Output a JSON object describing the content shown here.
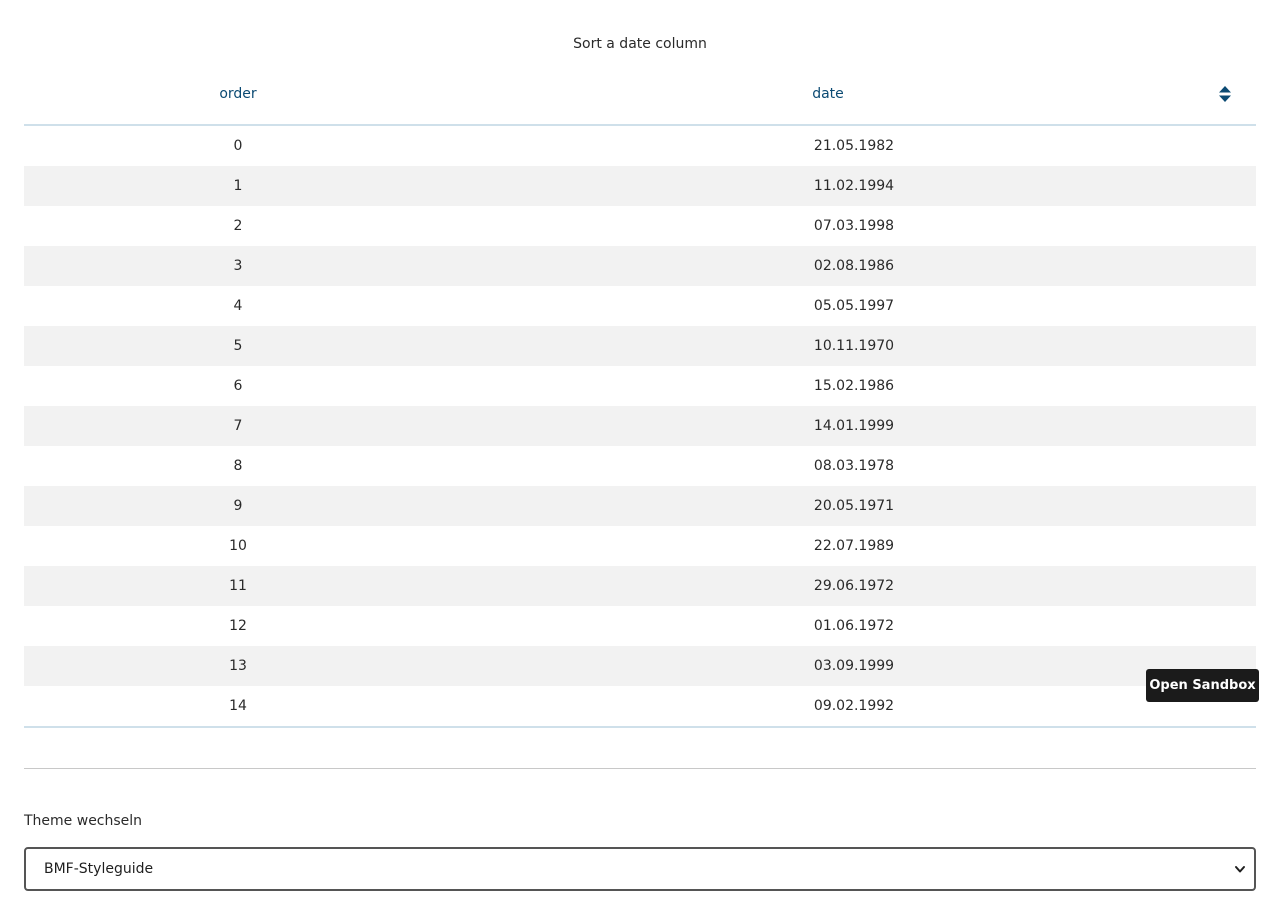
{
  "caption": "Sort a date column",
  "table": {
    "headers": {
      "order": "order",
      "date": "date"
    },
    "sort_icon": "sort-up-down-icon",
    "rows": [
      {
        "order": "0",
        "date": "21.05.1982"
      },
      {
        "order": "1",
        "date": "11.02.1994"
      },
      {
        "order": "2",
        "date": "07.03.1998"
      },
      {
        "order": "3",
        "date": "02.08.1986"
      },
      {
        "order": "4",
        "date": "05.05.1997"
      },
      {
        "order": "5",
        "date": "10.11.1970"
      },
      {
        "order": "6",
        "date": "15.02.1986"
      },
      {
        "order": "7",
        "date": "14.01.1999"
      },
      {
        "order": "8",
        "date": "08.03.1978"
      },
      {
        "order": "9",
        "date": "20.05.1971"
      },
      {
        "order": "10",
        "date": "22.07.1989"
      },
      {
        "order": "11",
        "date": "29.06.1972"
      },
      {
        "order": "12",
        "date": "01.06.1972"
      },
      {
        "order": "13",
        "date": "03.09.1999"
      },
      {
        "order": "14",
        "date": "09.02.1992"
      }
    ]
  },
  "sandbox_button": "Open Sandbox",
  "theme": {
    "label": "Theme wechseln",
    "selected": "BMF-Styleguide",
    "chevron_icon": "chevron-down-icon"
  },
  "colors": {
    "header_text": "#0b4a73",
    "border": "#cfe0ea",
    "stripe": "#f2f2f2",
    "button_bg": "#1b1b1b"
  }
}
